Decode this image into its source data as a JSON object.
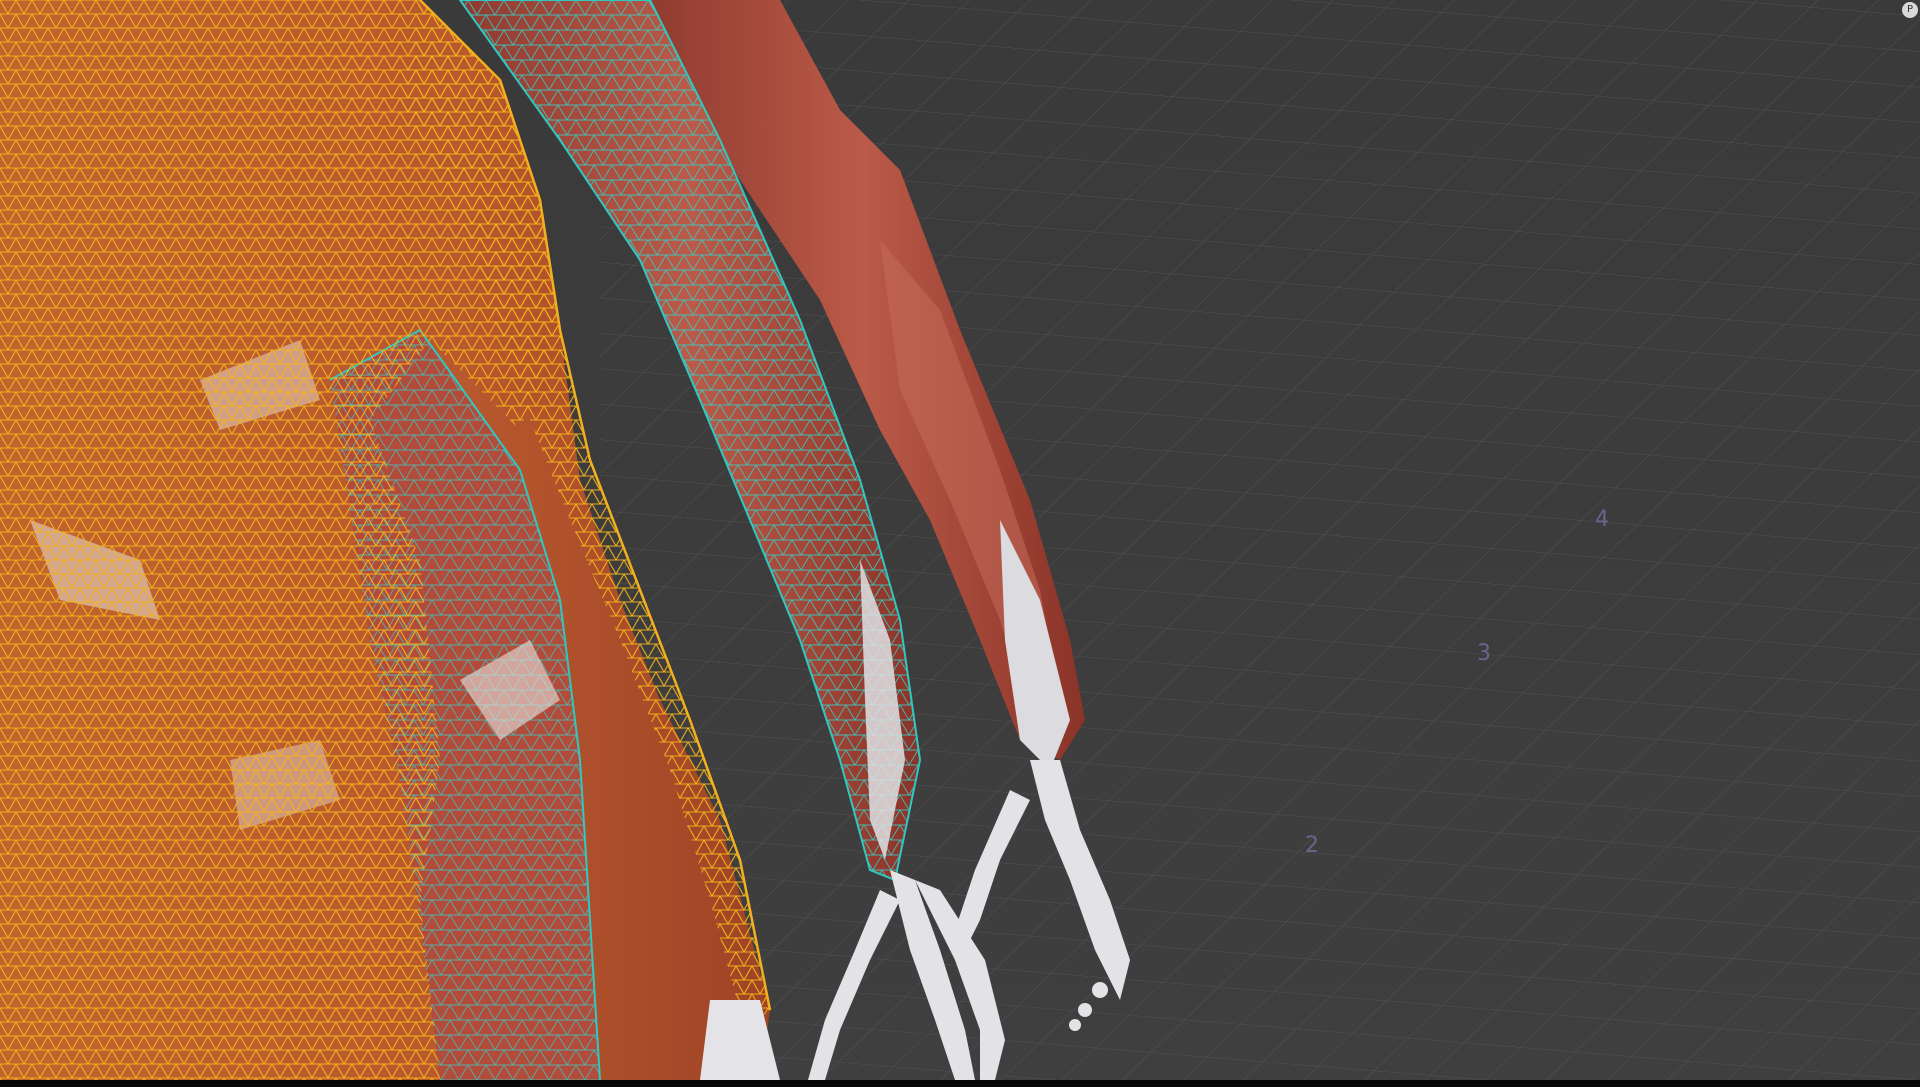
{
  "viewport": {
    "grid_labels": [
      "2",
      "3",
      "4"
    ],
    "corner_badge": "P"
  },
  "colors": {
    "background": "#3d3d3d",
    "grid_line": "#555555",
    "muscle": "#a8483a",
    "muscle_highlight": "#c9705d",
    "bone": "#e2e2e6",
    "selected_wireframe_primary": "#f2b01e",
    "selected_wireframe_secondary": "#2ec9c3"
  },
  "icons": {
    "corner_badge": "viewport-badge-icon"
  }
}
